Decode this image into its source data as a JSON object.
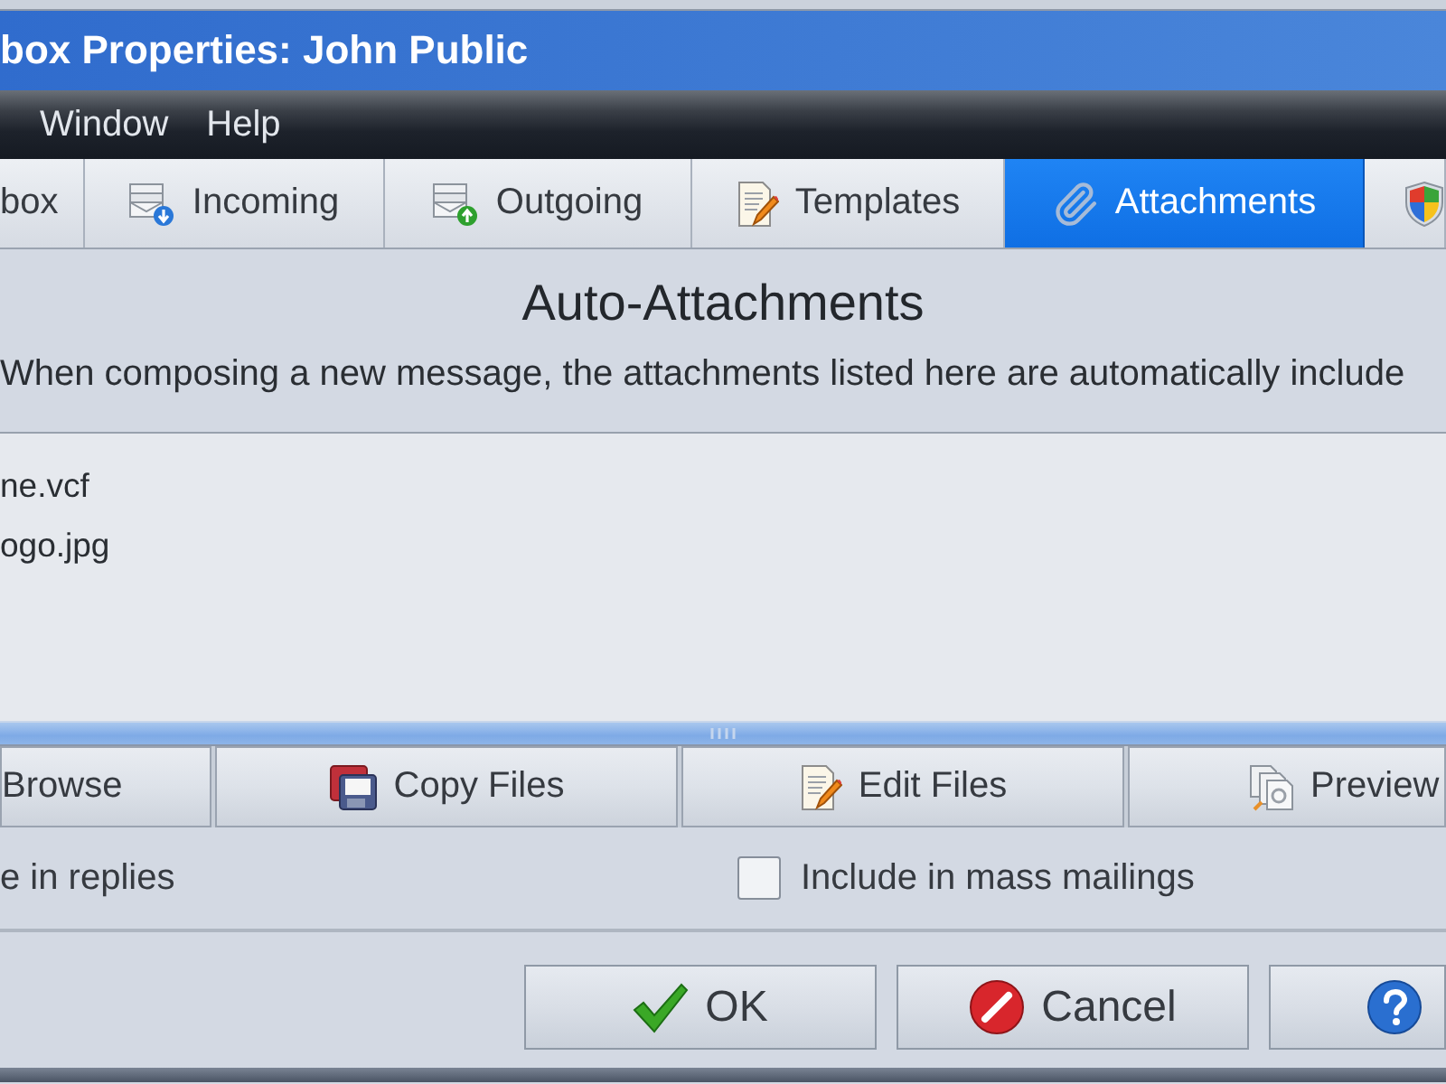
{
  "window": {
    "title": "box Properties: John Public"
  },
  "menu": [
    "Window",
    "Help"
  ],
  "tabs": [
    {
      "label": "box",
      "selected": false
    },
    {
      "label": "Incoming",
      "selected": false
    },
    {
      "label": "Outgoing",
      "selected": false
    },
    {
      "label": "Templates",
      "selected": false
    },
    {
      "label": "Attachments",
      "selected": true
    },
    {
      "selected": false
    }
  ],
  "panel": {
    "heading": "Auto-Attachments",
    "description": "When composing a new message, the attachments listed here are automatically include"
  },
  "attachments": [
    "ne.vcf",
    "ogo.jpg"
  ],
  "file_buttons": [
    "Browse",
    "Copy Files",
    "Edit Files",
    "Preview"
  ],
  "options": [
    {
      "label": "e in replies"
    },
    {
      "label": "Include in mass mailings",
      "checked": false
    }
  ],
  "dialog_buttons": [
    {
      "kind": "ok",
      "label": "OK"
    },
    {
      "kind": "cancel",
      "label": "Cancel"
    },
    {
      "kind": "help"
    }
  ]
}
